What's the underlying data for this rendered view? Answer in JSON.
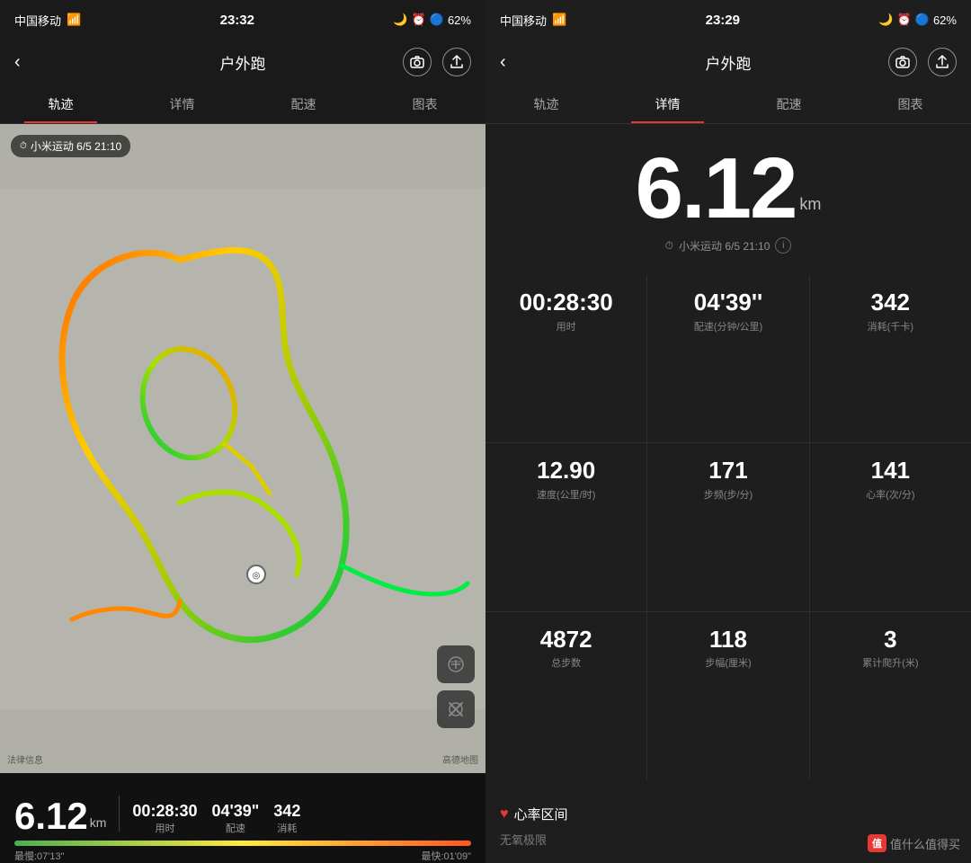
{
  "left": {
    "status_bar": {
      "carrier": "中国移动",
      "time": "23:32",
      "battery": "62%"
    },
    "header": {
      "back": "‹",
      "title": "户外跑",
      "camera_label": "📷",
      "share_label": "↑"
    },
    "tabs": [
      {
        "id": "track",
        "label": "轨迹",
        "active": true
      },
      {
        "id": "detail",
        "label": "详情",
        "active": false
      },
      {
        "id": "pace",
        "label": "配速",
        "active": false
      },
      {
        "id": "chart",
        "label": "图表",
        "active": false
      }
    ],
    "map": {
      "timestamp": "小米运动 6/5 21:10",
      "watermark": "法律信息",
      "brand": "高德地图"
    },
    "bottom_bar": {
      "distance": "6.12",
      "distance_unit": "km",
      "duration_value": "00:28:30",
      "duration_label": "用时",
      "pace_value": "04'39\"",
      "pace_label": "配速",
      "calorie_value": "342",
      "calorie_label": "消耗",
      "slowest_label": "最慢:07'13\"",
      "fastest_label": "最快:01'09\""
    }
  },
  "right": {
    "status_bar": {
      "carrier": "中国移动",
      "time": "23:29",
      "battery": "62%"
    },
    "header": {
      "back": "‹",
      "title": "户外跑",
      "camera_label": "📷",
      "share_label": "↑"
    },
    "tabs": [
      {
        "id": "track",
        "label": "轨迹",
        "active": false
      },
      {
        "id": "detail",
        "label": "详情",
        "active": true
      },
      {
        "id": "pace",
        "label": "配速",
        "active": false
      },
      {
        "id": "chart",
        "label": "图表",
        "active": false
      }
    ],
    "big_distance": {
      "value": "6.12",
      "unit": "km",
      "source": "小米运动 6/5 21:10"
    },
    "stats": [
      {
        "value": "00:28:30",
        "label": "用时"
      },
      {
        "value": "04'39''",
        "label": "配速(分钟/公里)"
      },
      {
        "value": "342",
        "label": "消耗(千卡)"
      },
      {
        "value": "12.90",
        "label": "速度(公里/时)"
      },
      {
        "value": "171",
        "label": "步频(步/分)"
      },
      {
        "value": "141",
        "label": "心率(次/分)"
      },
      {
        "value": "4872",
        "label": "总步数"
      },
      {
        "value": "118",
        "label": "步幅(厘米)"
      },
      {
        "value": "3",
        "label": "累计爬升(米)"
      }
    ],
    "heart_rate": {
      "title": "心率区间",
      "subtitle": "无氧极限"
    },
    "watermark": "值什么值得买"
  }
}
